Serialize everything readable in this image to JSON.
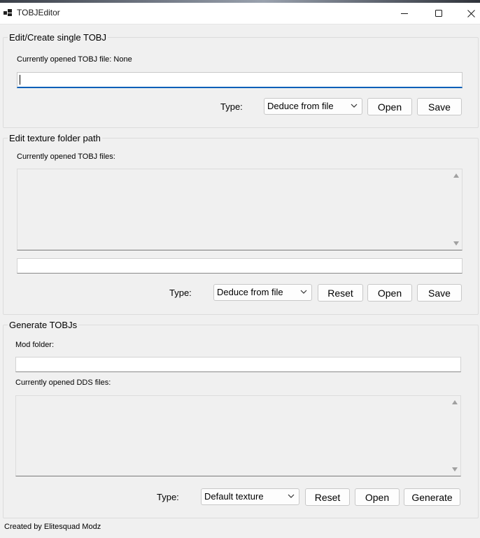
{
  "window": {
    "title": "TOBJEditor",
    "controls": {
      "minimize": "minimize",
      "maximize": "maximize",
      "close": "close"
    }
  },
  "single": {
    "group_title": "Edit/Create single TOBJ",
    "opened_label": "Currently opened TOBJ file: None",
    "path_value": "",
    "type_label": "Type:",
    "type_value": "Deduce from file",
    "open_label": "Open",
    "save_label": "Save"
  },
  "folder": {
    "group_title": "Edit texture folder path",
    "opened_label": "Currently opened TOBJ files:",
    "files": [],
    "path_value": "",
    "type_label": "Type:",
    "type_value": "Deduce from file",
    "reset_label": "Reset",
    "open_label": "Open",
    "save_label": "Save"
  },
  "generate": {
    "group_title": "Generate TOBJs",
    "mod_folder_label": "Mod folder:",
    "mod_folder_value": "",
    "opened_label": "Currently opened DDS files:",
    "files": [],
    "type_label": "Type:",
    "type_value": "Default texture",
    "reset_label": "Reset",
    "open_label": "Open",
    "generate_label": "Generate"
  },
  "footer": {
    "credit": "Created by Elitesquad Modz"
  },
  "icons": {
    "app": "app-window-icon",
    "minimize": "minimize-icon",
    "maximize": "maximize-icon",
    "close": "close-icon",
    "dropdown": "chevron-down-icon",
    "scroll_up": "scroll-up-arrow-icon",
    "scroll_down": "scroll-down-arrow-icon"
  },
  "colors": {
    "focus_accent": "#005fb8",
    "window_bg": "#f0f0f0"
  }
}
